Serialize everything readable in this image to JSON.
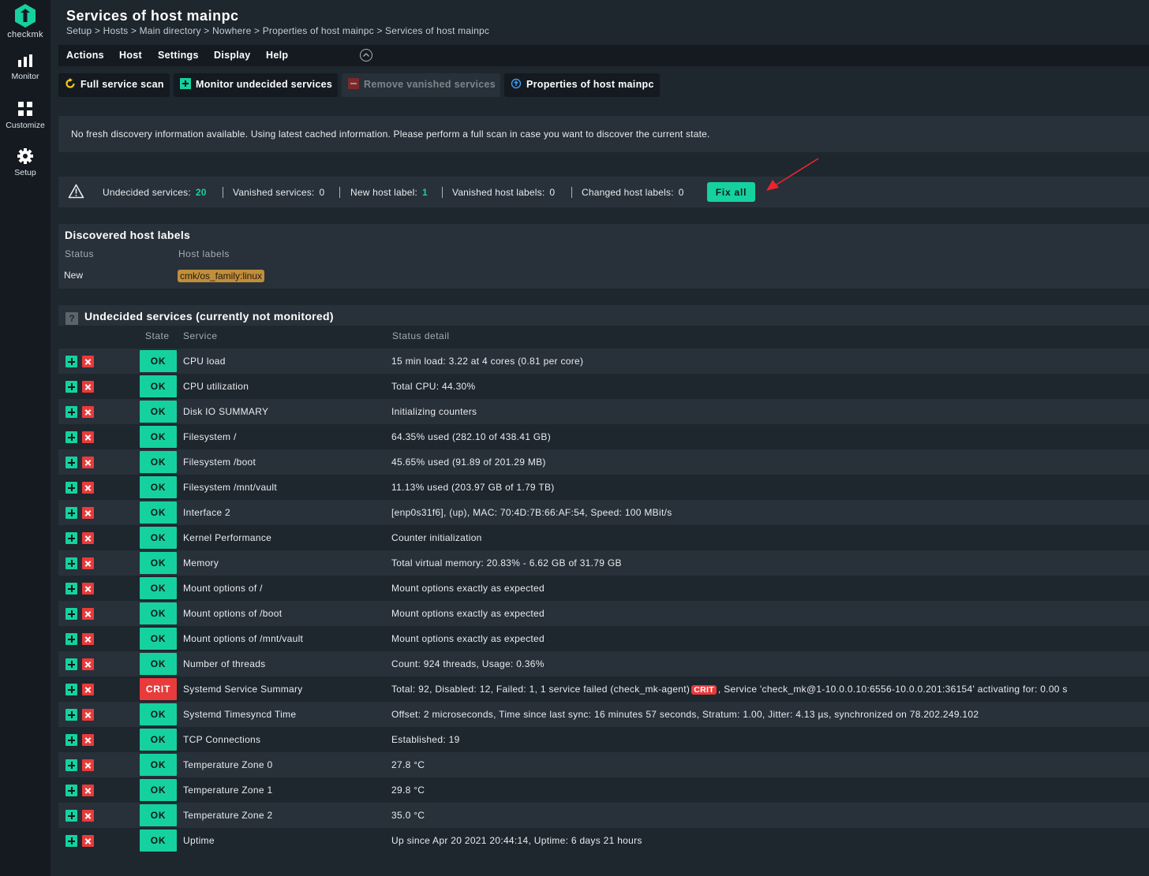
{
  "sidebar": {
    "logo_text": "checkmk",
    "items": [
      {
        "label": "Monitor",
        "icon": "bar-chart-icon"
      },
      {
        "label": "Customize",
        "icon": "grid-icon"
      },
      {
        "label": "Setup",
        "icon": "gear-icon"
      }
    ]
  },
  "header": {
    "title": "Services of host mainpc",
    "breadcrumb": "Setup > Hosts > Main directory > Nowhere > Properties of host mainpc > Services of host mainpc"
  },
  "menu": {
    "items": [
      "Actions",
      "Host",
      "Settings",
      "Display",
      "Help"
    ]
  },
  "toolbar": {
    "full_scan": "Full service scan",
    "monitor_undecided": "Monitor undecided services",
    "remove_vanished": "Remove vanished services",
    "properties": "Properties of host mainpc"
  },
  "info_message": "No fresh discovery information available. Using latest cached information. Please perform a full scan in case you want to discover the current state.",
  "summary": {
    "undecided_label": "Undecided services:",
    "undecided_value": "20",
    "vanished_label": "Vanished services:",
    "vanished_value": "0",
    "new_label_label": "New host label:",
    "new_label_value": "1",
    "vanished_labels_label": "Vanished host labels:",
    "vanished_labels_value": "0",
    "changed_labels_label": "Changed host labels:",
    "changed_labels_value": "0",
    "fix_all": "Fix all"
  },
  "host_labels": {
    "title": "Discovered host labels",
    "col_status": "Status",
    "col_labels": "Host labels",
    "row_status": "New",
    "row_label": "cmk/os_family:linux"
  },
  "services": {
    "title": "Undecided services (currently not monitored)",
    "help": "?",
    "col_state": "State",
    "col_service": "Service",
    "col_detail": "Status detail",
    "rows": [
      {
        "state": "OK",
        "service": "CPU load",
        "detail": "15 min load: 3.22 at 4 cores (0.81 per core)"
      },
      {
        "state": "OK",
        "service": "CPU utilization",
        "detail": "Total CPU: 44.30%"
      },
      {
        "state": "OK",
        "service": "Disk IO SUMMARY",
        "detail": "Initializing counters"
      },
      {
        "state": "OK",
        "service": "Filesystem /",
        "detail": "64.35% used (282.10 of 438.41 GB)"
      },
      {
        "state": "OK",
        "service": "Filesystem /boot",
        "detail": "45.65% used (91.89 of 201.29 MB)"
      },
      {
        "state": "OK",
        "service": "Filesystem /mnt/vault",
        "detail": "11.13% used (203.97 GB of 1.79 TB)"
      },
      {
        "state": "OK",
        "service": "Interface 2",
        "detail": "[enp0s31f6], (up), MAC: 70:4D:7B:66:AF:54, Speed: 100 MBit/s"
      },
      {
        "state": "OK",
        "service": "Kernel Performance",
        "detail": "Counter initialization"
      },
      {
        "state": "OK",
        "service": "Memory",
        "detail": "Total virtual memory: 20.83% - 6.62 GB of 31.79 GB"
      },
      {
        "state": "OK",
        "service": "Mount options of /",
        "detail": "Mount options exactly as expected"
      },
      {
        "state": "OK",
        "service": "Mount options of /boot",
        "detail": "Mount options exactly as expected"
      },
      {
        "state": "OK",
        "service": "Mount options of /mnt/vault",
        "detail": "Mount options exactly as expected"
      },
      {
        "state": "OK",
        "service": "Number of threads",
        "detail": "Count: 924 threads, Usage: 0.36%"
      },
      {
        "state": "CRIT",
        "service": "Systemd Service Summary",
        "detail": "Total: 92, Disabled: 12, Failed: 1, 1 service failed (check_mk-agent)",
        "detail_badge": "CRIT",
        "detail_suffix": ", Service 'check_mk@1-10.0.0.10:6556-10.0.0.201:36154' activating for: 0.00 s"
      },
      {
        "state": "OK",
        "service": "Systemd Timesyncd Time",
        "detail": "Offset: 2 microseconds, Time since last sync: 16 minutes 57 seconds, Stratum: 1.00, Jitter: 4.13 µs, synchronized on 78.202.249.102"
      },
      {
        "state": "OK",
        "service": "TCP Connections",
        "detail": "Established: 19"
      },
      {
        "state": "OK",
        "service": "Temperature Zone 0",
        "detail": "27.8 °C"
      },
      {
        "state": "OK",
        "service": "Temperature Zone 1",
        "detail": "29.8 °C"
      },
      {
        "state": "OK",
        "service": "Temperature Zone 2",
        "detail": "35.0 °C"
      },
      {
        "state": "OK",
        "service": "Uptime",
        "detail": "Up since Apr 20 2021 20:44:14, Uptime: 6 days 21 hours"
      }
    ]
  },
  "colors": {
    "accent": "#15d1a0",
    "crit": "#e83b3b",
    "label_chip": "#c18e3b",
    "annotation_arrow": "#e8262b"
  }
}
